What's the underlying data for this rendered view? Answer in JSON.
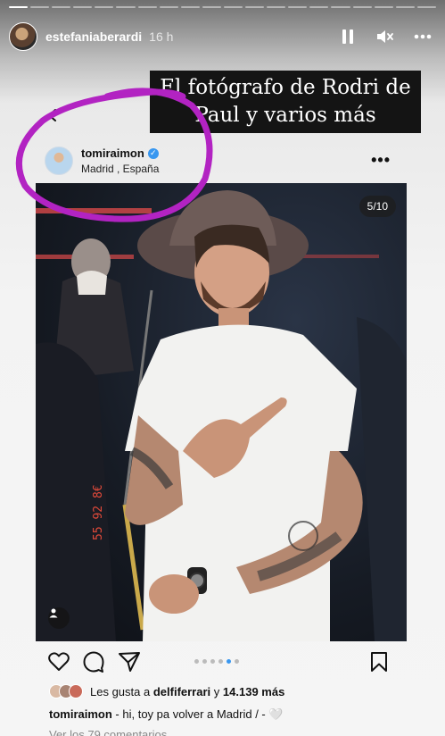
{
  "story": {
    "progress": {
      "total": 20,
      "current": 1
    },
    "username": "estefaniaberardi",
    "time": "16 h",
    "controls": {
      "pause": "pause-icon",
      "mute": "mute-icon",
      "more": "more-icon"
    }
  },
  "overlay_caption": {
    "line1": "El fotógrafo de Rodri de",
    "line2": "Paul y varios más"
  },
  "post": {
    "username": "tomiraimon",
    "verified": true,
    "location": "Madrid , España",
    "more": "•••",
    "media_counter": "5/10",
    "carousel": {
      "total": 10,
      "visible_dots": 6,
      "active_index": 4
    },
    "likes": {
      "prefix": "Les gusta a",
      "user": "delfiferrari",
      "connector": "y",
      "count": "14.139 más"
    },
    "caption": {
      "user": "tomiraimon",
      "text": "- hi, toy pa volver a Madrid / - 🤍"
    },
    "comments_link": "Ver los 79 comentarios",
    "photo_text": "55 92 8€"
  },
  "colors": {
    "annotation": "#b223c2",
    "verified": "#3897f0",
    "active_dot": "#3897f0"
  }
}
